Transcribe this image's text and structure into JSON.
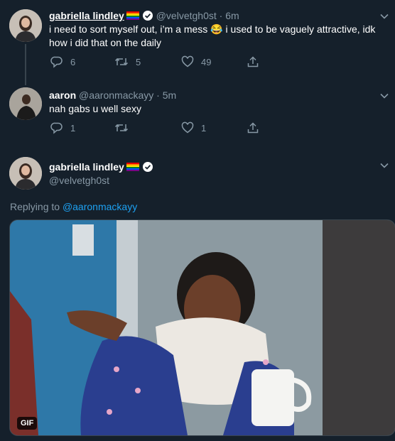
{
  "tweets": [
    {
      "name": "gabriella lindley",
      "flag_icon": "rainbow-flag-icon",
      "verified_icon": "verified-badge-icon",
      "handle": "@velvetgh0st",
      "dot": "·",
      "time": "6m",
      "text_part1": "i need to sort myself out, i’m a mess ",
      "emoji": "😂",
      "text_part2": " i used to be vaguely attractive, idk how i did that on the daily",
      "replies": "6",
      "retweets": "5",
      "likes": "49"
    },
    {
      "name": "aaron",
      "handle": "@aaronmackayy",
      "dot": "·",
      "time": "5m",
      "text": "nah gabs u well sexy",
      "replies": "1",
      "retweets": "",
      "likes": "1"
    },
    {
      "name": "gabriella lindley",
      "handle": "@velvetgh0st",
      "replying_prefix": "Replying to",
      "replying_to": "@aaronmackayy",
      "gif_badge": "GIF"
    }
  ],
  "colors": {
    "background": "#15202b",
    "muted": "#8899a6",
    "link": "#1da1f2",
    "divider": "#38444d"
  }
}
